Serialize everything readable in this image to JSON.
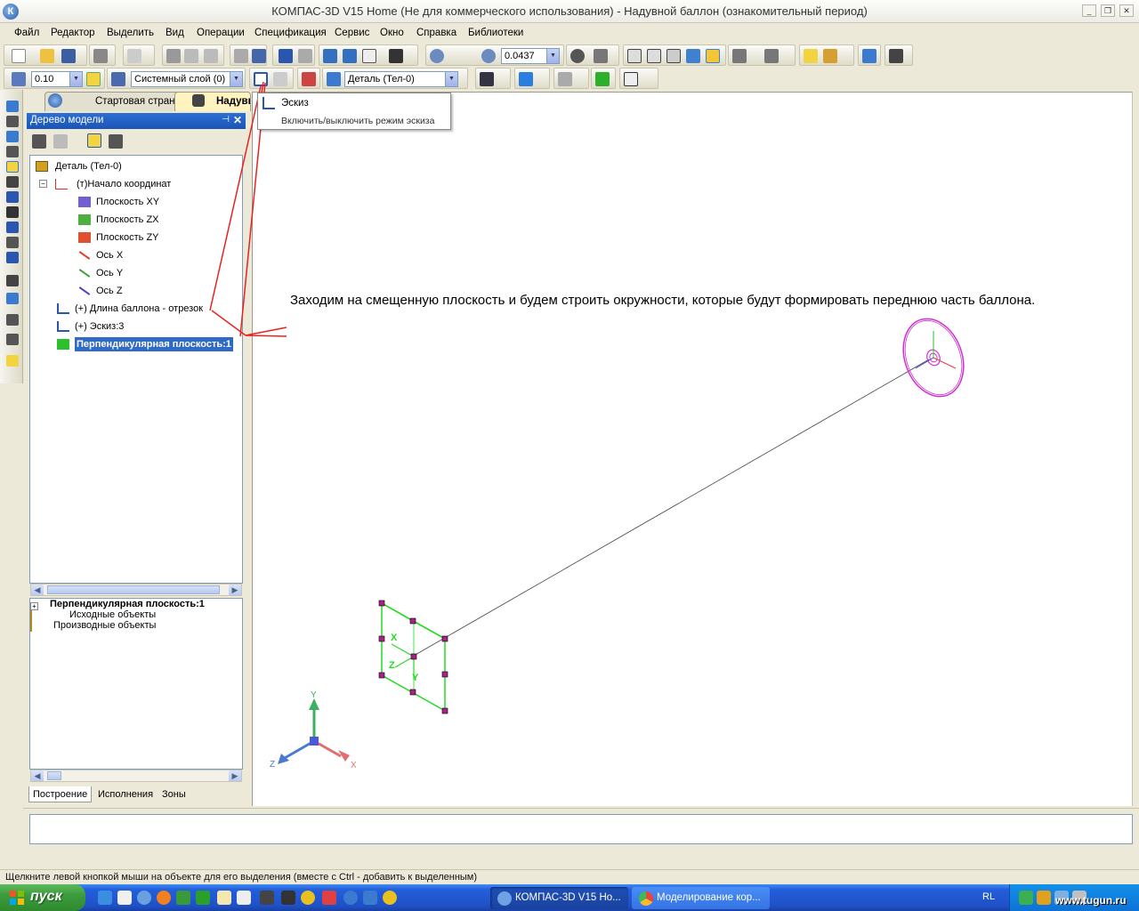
{
  "window": {
    "title": "КОМПАС-3D V15 Home (Не для коммерческого использования) - Надувной баллон (ознакомительный период)",
    "logo": "К"
  },
  "menu": [
    "Файл",
    "Редактор",
    "Выделить",
    "Вид",
    "Операции",
    "Спецификация",
    "Сервис",
    "Окно",
    "Справка",
    "Библиотеки"
  ],
  "toolbar1": {
    "zoom_value": "0.0437"
  },
  "toolbar2": {
    "step_value": "0.10",
    "layer_value": "Системный слой (0)",
    "part_value": "Деталь (Тел-0)"
  },
  "tabs": {
    "start": "Стартовая страница",
    "doc": "Надувной баллон"
  },
  "panel": {
    "title": "Дерево модели",
    "pin": "⊣",
    "close": "✕"
  },
  "tree": {
    "root": "Деталь (Тел-0)",
    "origin": "(т)Начало координат",
    "plane_xy": "Плоскость XY",
    "plane_zx": "Плоскость ZX",
    "plane_zy": "Плоскость ZY",
    "axis_x": "Ось X",
    "axis_y": "Ось Y",
    "axis_z": "Ось Z",
    "length": "(+) Длина баллона - отрезок",
    "sketch3": "(+) Эскиз:3",
    "perp_plane": "Перпендикулярная плоскость:1"
  },
  "tree2": {
    "title": "Перпендикулярная плоскость:1",
    "source": "Исходные объекты",
    "derived": "Производные объекты"
  },
  "bottom_tabs": [
    "Построение",
    "Исполнения",
    "Зоны"
  ],
  "tooltip": {
    "title": "Эскиз",
    "description": "Включить/выключить режим эскиза"
  },
  "annotation": "Заходим на смещенную плоскость и будем строить окружности, которые будут формировать переднюю часть баллона.",
  "axis_labels": {
    "x": "X",
    "y": "Y",
    "z": "Z"
  },
  "status": "Щелкните левой кнопкой мыши на объекте для его выделения (вместе с Ctrl - добавить к выделенным)",
  "taskbar": {
    "start": "пуск",
    "items": [
      "КОМПАС-3D V15 Ho...",
      "Моделирование кор..."
    ],
    "lang": "RL",
    "watermark": "www.tugun.ru"
  },
  "colors": {
    "accent_red": "#e8231f",
    "selection_blue": "#3169c6",
    "plane_green": "#22dd22",
    "circle_magenta": "#d030d0"
  }
}
